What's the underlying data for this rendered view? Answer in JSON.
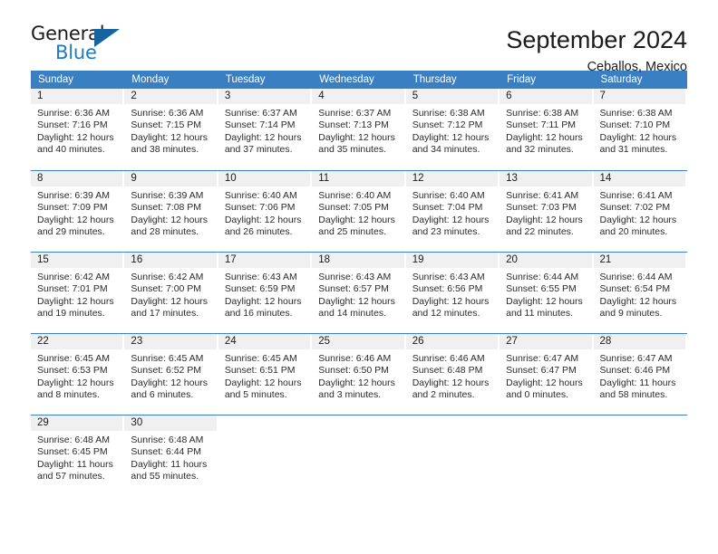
{
  "brand": {
    "name_top": "General",
    "name_bottom": "Blue",
    "triangle_icon": "blue-triangle-icon",
    "accent_color": "#15639f",
    "blue_text_color": "#1f7ac4"
  },
  "header": {
    "title": "September 2024",
    "subtitle": "Ceballos, Mexico"
  },
  "calendar": {
    "header_bg": "#3a7fc1",
    "day_band_bg": "#f0f0f0",
    "weekdays": [
      "Sunday",
      "Monday",
      "Tuesday",
      "Wednesday",
      "Thursday",
      "Friday",
      "Saturday"
    ],
    "weeks": [
      [
        {
          "day": "1",
          "lines": [
            "Sunrise: 6:36 AM",
            "Sunset: 7:16 PM",
            "Daylight: 12 hours",
            "and 40 minutes."
          ]
        },
        {
          "day": "2",
          "lines": [
            "Sunrise: 6:36 AM",
            "Sunset: 7:15 PM",
            "Daylight: 12 hours",
            "and 38 minutes."
          ]
        },
        {
          "day": "3",
          "lines": [
            "Sunrise: 6:37 AM",
            "Sunset: 7:14 PM",
            "Daylight: 12 hours",
            "and 37 minutes."
          ]
        },
        {
          "day": "4",
          "lines": [
            "Sunrise: 6:37 AM",
            "Sunset: 7:13 PM",
            "Daylight: 12 hours",
            "and 35 minutes."
          ]
        },
        {
          "day": "5",
          "lines": [
            "Sunrise: 6:38 AM",
            "Sunset: 7:12 PM",
            "Daylight: 12 hours",
            "and 34 minutes."
          ]
        },
        {
          "day": "6",
          "lines": [
            "Sunrise: 6:38 AM",
            "Sunset: 7:11 PM",
            "Daylight: 12 hours",
            "and 32 minutes."
          ]
        },
        {
          "day": "7",
          "lines": [
            "Sunrise: 6:38 AM",
            "Sunset: 7:10 PM",
            "Daylight: 12 hours",
            "and 31 minutes."
          ]
        }
      ],
      [
        {
          "day": "8",
          "lines": [
            "Sunrise: 6:39 AM",
            "Sunset: 7:09 PM",
            "Daylight: 12 hours",
            "and 29 minutes."
          ]
        },
        {
          "day": "9",
          "lines": [
            "Sunrise: 6:39 AM",
            "Sunset: 7:08 PM",
            "Daylight: 12 hours",
            "and 28 minutes."
          ]
        },
        {
          "day": "10",
          "lines": [
            "Sunrise: 6:40 AM",
            "Sunset: 7:06 PM",
            "Daylight: 12 hours",
            "and 26 minutes."
          ]
        },
        {
          "day": "11",
          "lines": [
            "Sunrise: 6:40 AM",
            "Sunset: 7:05 PM",
            "Daylight: 12 hours",
            "and 25 minutes."
          ]
        },
        {
          "day": "12",
          "lines": [
            "Sunrise: 6:40 AM",
            "Sunset: 7:04 PM",
            "Daylight: 12 hours",
            "and 23 minutes."
          ]
        },
        {
          "day": "13",
          "lines": [
            "Sunrise: 6:41 AM",
            "Sunset: 7:03 PM",
            "Daylight: 12 hours",
            "and 22 minutes."
          ]
        },
        {
          "day": "14",
          "lines": [
            "Sunrise: 6:41 AM",
            "Sunset: 7:02 PM",
            "Daylight: 12 hours",
            "and 20 minutes."
          ]
        }
      ],
      [
        {
          "day": "15",
          "lines": [
            "Sunrise: 6:42 AM",
            "Sunset: 7:01 PM",
            "Daylight: 12 hours",
            "and 19 minutes."
          ]
        },
        {
          "day": "16",
          "lines": [
            "Sunrise: 6:42 AM",
            "Sunset: 7:00 PM",
            "Daylight: 12 hours",
            "and 17 minutes."
          ]
        },
        {
          "day": "17",
          "lines": [
            "Sunrise: 6:43 AM",
            "Sunset: 6:59 PM",
            "Daylight: 12 hours",
            "and 16 minutes."
          ]
        },
        {
          "day": "18",
          "lines": [
            "Sunrise: 6:43 AM",
            "Sunset: 6:57 PM",
            "Daylight: 12 hours",
            "and 14 minutes."
          ]
        },
        {
          "day": "19",
          "lines": [
            "Sunrise: 6:43 AM",
            "Sunset: 6:56 PM",
            "Daylight: 12 hours",
            "and 12 minutes."
          ]
        },
        {
          "day": "20",
          "lines": [
            "Sunrise: 6:44 AM",
            "Sunset: 6:55 PM",
            "Daylight: 12 hours",
            "and 11 minutes."
          ]
        },
        {
          "day": "21",
          "lines": [
            "Sunrise: 6:44 AM",
            "Sunset: 6:54 PM",
            "Daylight: 12 hours",
            "and 9 minutes."
          ]
        }
      ],
      [
        {
          "day": "22",
          "lines": [
            "Sunrise: 6:45 AM",
            "Sunset: 6:53 PM",
            "Daylight: 12 hours",
            "and 8 minutes."
          ]
        },
        {
          "day": "23",
          "lines": [
            "Sunrise: 6:45 AM",
            "Sunset: 6:52 PM",
            "Daylight: 12 hours",
            "and 6 minutes."
          ]
        },
        {
          "day": "24",
          "lines": [
            "Sunrise: 6:45 AM",
            "Sunset: 6:51 PM",
            "Daylight: 12 hours",
            "and 5 minutes."
          ]
        },
        {
          "day": "25",
          "lines": [
            "Sunrise: 6:46 AM",
            "Sunset: 6:50 PM",
            "Daylight: 12 hours",
            "and 3 minutes."
          ]
        },
        {
          "day": "26",
          "lines": [
            "Sunrise: 6:46 AM",
            "Sunset: 6:48 PM",
            "Daylight: 12 hours",
            "and 2 minutes."
          ]
        },
        {
          "day": "27",
          "lines": [
            "Sunrise: 6:47 AM",
            "Sunset: 6:47 PM",
            "Daylight: 12 hours",
            "and 0 minutes."
          ]
        },
        {
          "day": "28",
          "lines": [
            "Sunrise: 6:47 AM",
            "Sunset: 6:46 PM",
            "Daylight: 11 hours",
            "and 58 minutes."
          ]
        }
      ],
      [
        {
          "day": "29",
          "lines": [
            "Sunrise: 6:48 AM",
            "Sunset: 6:45 PM",
            "Daylight: 11 hours",
            "and 57 minutes."
          ]
        },
        {
          "day": "30",
          "lines": [
            "Sunrise: 6:48 AM",
            "Sunset: 6:44 PM",
            "Daylight: 11 hours",
            "and 55 minutes."
          ]
        },
        {
          "day": "",
          "lines": []
        },
        {
          "day": "",
          "lines": []
        },
        {
          "day": "",
          "lines": []
        },
        {
          "day": "",
          "lines": []
        },
        {
          "day": "",
          "lines": []
        }
      ]
    ]
  }
}
